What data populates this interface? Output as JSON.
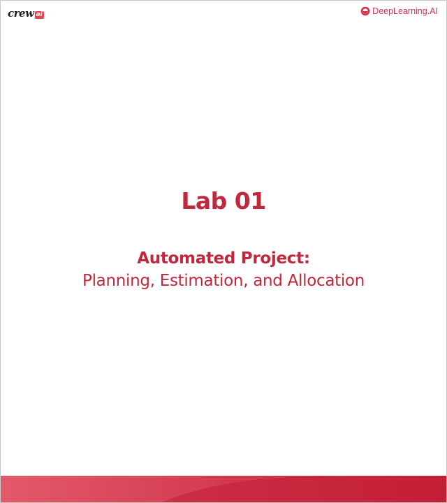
{
  "header": {
    "left_logo": {
      "icon": "crewai-logo-icon",
      "word": "crew",
      "badge": "ai"
    },
    "right_logo": {
      "icon": "deeplearning-ai-logo-icon",
      "text": "DeepLearning.AI"
    }
  },
  "main": {
    "title": "Lab 01",
    "subtitle_bold": "Automated Project:",
    "subtitle_regular": "Planning, Estimation, and Allocation"
  },
  "colors": {
    "accent": "#c1283e",
    "logo_red": "#d6334a",
    "band_light": "#e25a6a",
    "band_dark": "#c21f36"
  }
}
